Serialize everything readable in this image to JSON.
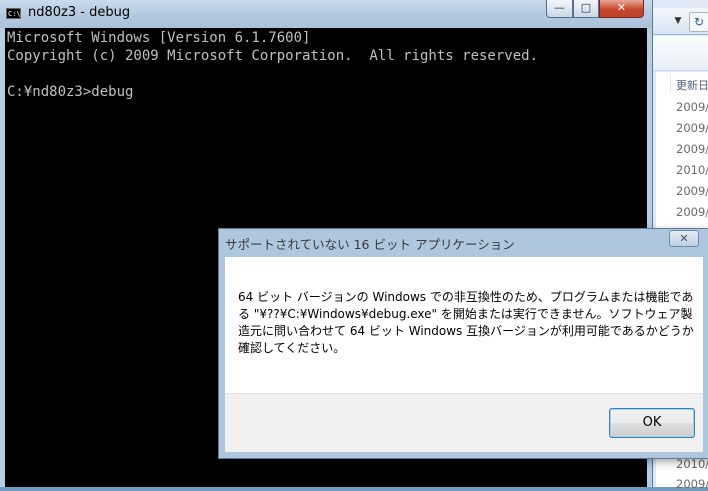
{
  "explorer": {
    "dropdown_glyph": "▼",
    "refresh_glyph": "↻",
    "column_header": "更新日",
    "dates": [
      "2009/",
      "2009/",
      "2009/",
      "2010/",
      "2009/",
      "2009/"
    ],
    "bottom_dates": [
      "2010/",
      "2009/"
    ]
  },
  "cmd": {
    "title": "nd80z3 - debug",
    "icon_text": "C:\\",
    "buttons": {
      "minimize": "—",
      "maximize": "□",
      "close": "✕"
    },
    "lines": [
      "Microsoft Windows [Version 6.1.7600]",
      "Copyright (c) 2009 Microsoft Corporation.  All rights reserved.",
      "",
      "C:¥nd80z3>debug"
    ]
  },
  "dialog": {
    "title": "サポートされていない 16 ビット アプリケーション",
    "close_glyph": "✕",
    "message": "64 ビット バージョンの Windows での非互換性のため、プログラムまたは機能である \"¥??¥C:¥Windows¥debug.exe\" を開始または実行できません。ソフトウェア製造元に問い合わせて 64 ビット Windows 互換バージョンが利用可能であるかどうか確認してください。",
    "ok_label": "OK"
  }
}
